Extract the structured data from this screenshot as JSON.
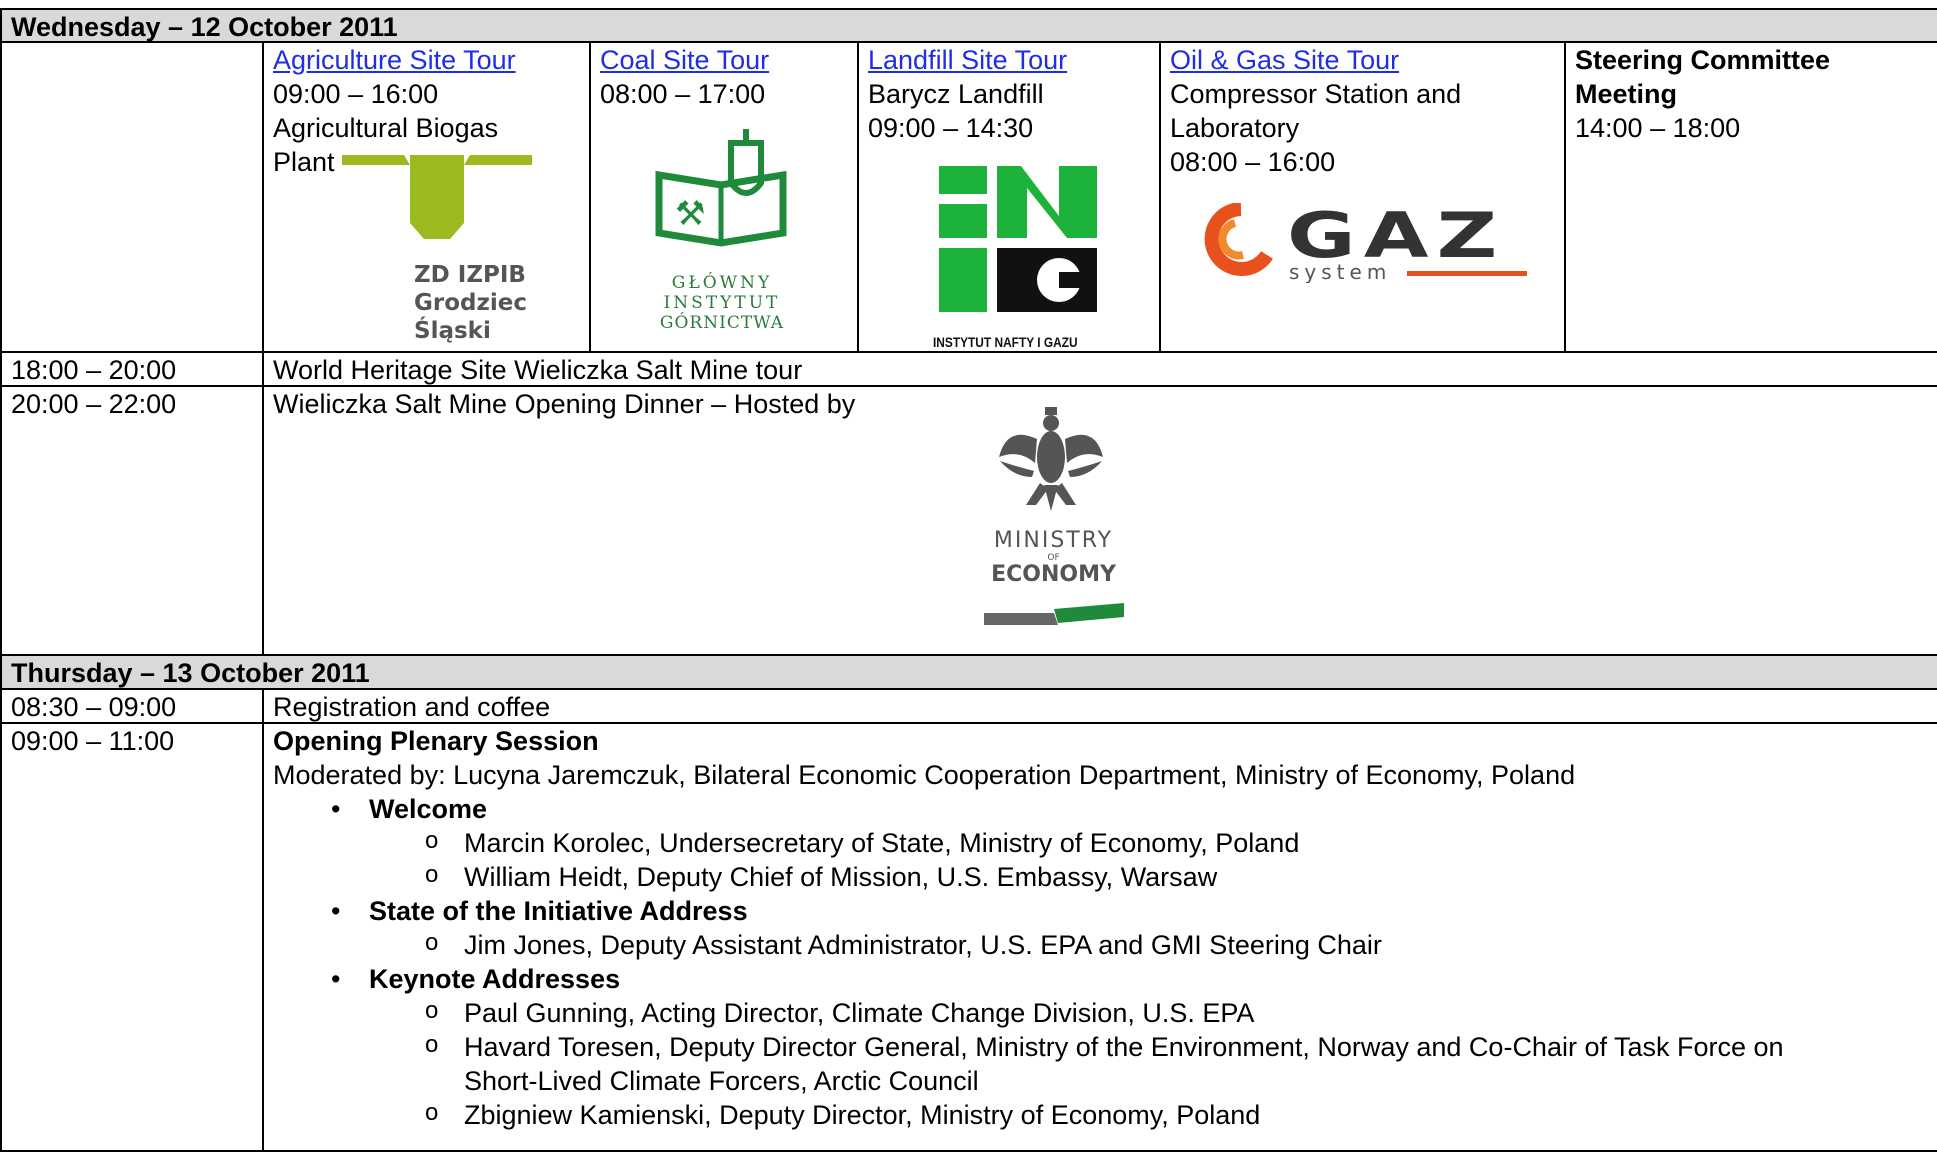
{
  "day1": {
    "header": "Wednesday – 12 October 2011",
    "tours": [
      {
        "link": "Agriculture Site Tour",
        "time": "09:00 – 16:00",
        "place": "Agricultural Biogas",
        "place2": "Plant"
      },
      {
        "link": "Coal Site Tour",
        "time": "08:00 – 17:00"
      },
      {
        "link": "Landfill Site Tour",
        "place": "Barycz Landfill",
        "time": "09:00 – 14:30"
      },
      {
        "link": "Oil & Gas Site Tour",
        "place": "Compressor Station and",
        "place2": "Laboratory",
        "time": "08:00 – 16:00"
      },
      {
        "title1": "Steering Committee",
        "title2": "Meeting",
        "time": "14:00 – 18:00"
      }
    ],
    "logos": {
      "agri": {
        "line1": "ZD IZPIB",
        "line2": "Grodziec",
        "line3": "Śląski",
        "icon": "izpib-logo",
        "color": "#9bba1f"
      },
      "coal": {
        "line1": "GŁÓWNY",
        "line2": "INSTYTUT",
        "line3": "GÓRNICTWA",
        "icon": "mining-institute-logo",
        "color": "#1e8a3a"
      },
      "landfill": {
        "text": "INSTYTUT NAFTY I GAZU",
        "icon": "ing-logo",
        "color": "#1db33a"
      },
      "gaz": {
        "word": "GAZ",
        "sub": "system",
        "icon": "gaz-system-logo",
        "color": "#e8501e"
      },
      "ministry": {
        "line1": "MINISTRY",
        "line2": "OF",
        "line3": "ECONOMY",
        "icon": "polish-eagle-logo"
      }
    },
    "rows": [
      {
        "time": "18:00 – 20:00",
        "desc": "World Heritage Site Wieliczka Salt Mine tour"
      },
      {
        "time": "20:00 – 22:00",
        "desc": "Wieliczka Salt Mine Opening Dinner – Hosted by"
      }
    ]
  },
  "day2": {
    "header": "Thursday – 13 October 2011",
    "rows": [
      {
        "time": "08:30 – 09:00",
        "desc": "Registration and coffee"
      },
      {
        "time": "09:00 – 11:00"
      }
    ],
    "plenary": {
      "title": "Opening Plenary Session",
      "moderator": "Moderated by:  Lucyna Jaremczuk, Bilateral Economic Cooperation Department, Ministry of Economy, Poland",
      "sections": [
        {
          "title": "Welcome",
          "items": [
            "Marcin Korolec, Undersecretary of State, Ministry of Economy, Poland",
            "William Heidt, Deputy Chief of Mission, U.S. Embassy, Warsaw"
          ]
        },
        {
          "title": "State of the Initiative Address",
          "items": [
            "Jim Jones, Deputy Assistant Administrator, U.S. EPA and GMI Steering Chair"
          ]
        },
        {
          "title": "Keynote Addresses",
          "items": [
            "Paul Gunning, Acting Director, Climate Change Division, U.S. EPA",
            "Havard Toresen, Deputy Director General, Ministry of the Environment, Norway and Co-Chair of Task Force on",
            "Short-Lived Climate Forcers, Arctic Council",
            "Zbigniew Kamienski, Deputy Director, Ministry of Economy, Poland"
          ]
        }
      ]
    }
  }
}
